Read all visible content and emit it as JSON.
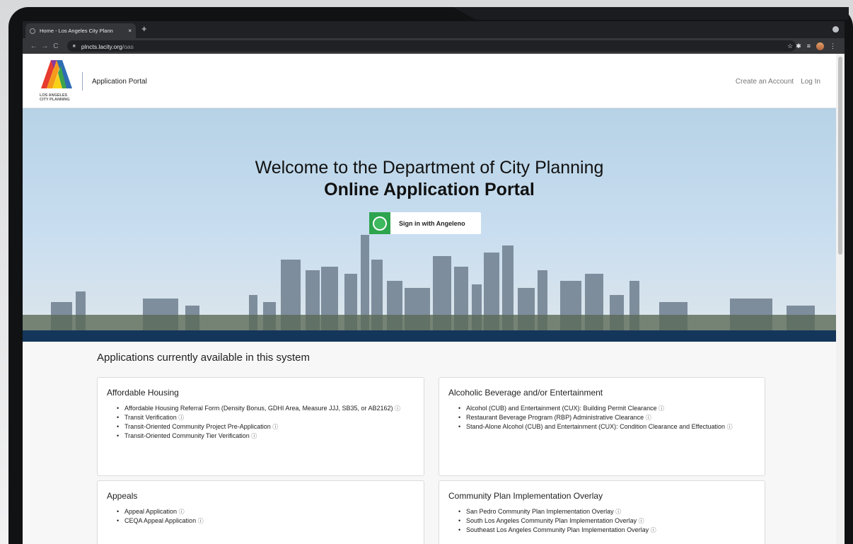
{
  "browser": {
    "tab_title": "Home - Los Angeles City Plann",
    "tab_close": "×",
    "new_tab": "+",
    "url_host": "plncts.lacity.org",
    "url_path": "/oas",
    "nav_back": "←",
    "nav_forward": "→",
    "nav_reload": "C",
    "lock": "🔒",
    "star": "☆",
    "puzzle": "✱",
    "media": "≡",
    "menu": "⋮"
  },
  "header": {
    "logo_line1": "LOS ANGELES",
    "logo_line2": "CITY PLANNING",
    "portal_title": "Application Portal",
    "create_account": "Create an Account",
    "log_in": "Log In"
  },
  "hero": {
    "title": "Welcome to the Department of City Planning",
    "subtitle": "Online Application Portal",
    "signin_label": "Sign in with Angeleno"
  },
  "applications": {
    "heading": "Applications currently available in this system",
    "info_icon": "ⓘ",
    "cards": [
      {
        "title": "Affordable Housing",
        "items": [
          "Affordable Housing Referral Form (Density Bonus, GDHI Area, Measure JJJ, SB35, or AB2162)",
          "Transit Verification",
          "Transit-Oriented Community Project Pre-Application",
          "Transit-Oriented Community Tier Verification"
        ]
      },
      {
        "title": "Alcoholic Beverage and/or Entertainment",
        "items": [
          "Alcohol (CUB) and Entertainment (CUX): Building Permit Clearance",
          "Restaurant Beverage Program (RBP) Administrative Clearance",
          "Stand-Alone Alcohol (CUB) and Entertainment (CUX): Condition Clearance and Effectuation"
        ]
      },
      {
        "title": "Appeals",
        "items": [
          "Appeal Application",
          "CEQA Appeal Application"
        ]
      },
      {
        "title": "Community Plan Implementation Overlay",
        "items": [
          "San Pedro Community Plan Implementation Overlay",
          "South Los Angeles Community Plan Implementation Overlay",
          "Southeast Los Angeles Community Plan Implementation Overlay"
        ]
      }
    ]
  },
  "colors": {
    "hero_band": "#14365a",
    "signin_green": "#2da44e",
    "chrome_dark": "#202124"
  }
}
